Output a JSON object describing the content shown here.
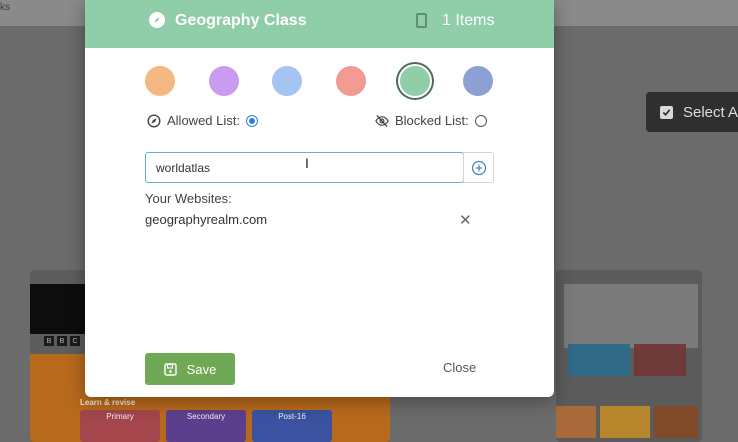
{
  "background": {
    "topbar_text": "ks",
    "select_button_label": "Select A",
    "bbc_letters": [
      "B",
      "B",
      "C"
    ],
    "learn_revise": "Learn & revise",
    "tiles": [
      "Primary",
      "Secondary",
      "Post-16"
    ]
  },
  "modal": {
    "title": "Geography Class",
    "item_count": "1 Items",
    "colors": [
      "#f4b982",
      "#c79cf2",
      "#a6c4f2",
      "#f29b93",
      "#8fcea9",
      "#8ca0d4"
    ],
    "selected_color_index": 4,
    "allowed_list_label": "Allowed List:",
    "blocked_list_label": "Blocked List:",
    "allowed_selected": true,
    "input_value": "worldatlas",
    "your_websites_label": "Your Websites:",
    "websites": [
      "geographyrealm.com"
    ],
    "save_label": "Save",
    "close_label": "Close"
  }
}
